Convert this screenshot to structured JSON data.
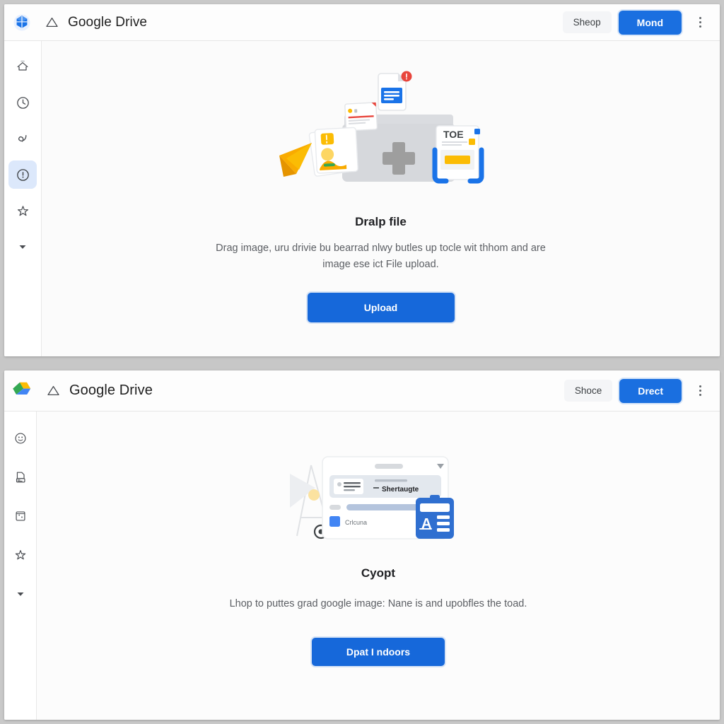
{
  "panels": [
    {
      "logo_icon": "drive-logo-blue-octagon-icon",
      "menu_icon": "triangle-menu-icon",
      "title": "Google Drive",
      "secondary_button": "Sheop",
      "primary_button": "Mond",
      "kebab_icon": "more-vertical-icon",
      "rail": [
        {
          "icon": "home-icon",
          "active": false
        },
        {
          "icon": "recent-clock-icon",
          "active": false
        },
        {
          "icon": "shared-arrow-icon",
          "active": false
        },
        {
          "icon": "info-circle-icon",
          "active": true
        },
        {
          "icon": "starred-icon",
          "active": false
        },
        {
          "icon": "chevron-down-icon",
          "active": false
        }
      ],
      "illustration": "drag-drop-folder-files-illustration",
      "headline": "Dralp file",
      "subtext": "Drag image, uru drivie bu bearrad nlwy butles up tocle wit thhom and are image ese ict File upload.",
      "cta_button": "Upload",
      "accent_color": "#1668da"
    },
    {
      "logo_icon": "google-drive-triangle-logo-icon",
      "menu_icon": "triangle-menu-icon",
      "title": "Google Drive",
      "secondary_button": "Shoce",
      "primary_button": "Drect",
      "kebab_icon": "more-vertical-icon",
      "rail": [
        {
          "icon": "smiley-circle-icon",
          "active": false
        },
        {
          "icon": "document-upload-icon",
          "active": false
        },
        {
          "icon": "calendar-square-icon",
          "active": false
        },
        {
          "icon": "starred-icon",
          "active": false
        },
        {
          "icon": "chevron-down-icon",
          "active": false
        }
      ],
      "illustration": "browser-window-translate-clipboard-illustration",
      "headline": "Cyopt",
      "subtext": "Lhop to puttes grad google image: Nane is and upobfles the toad.",
      "cta_button": "Dpat I ndoors",
      "accent_color": "#1668da"
    }
  ]
}
